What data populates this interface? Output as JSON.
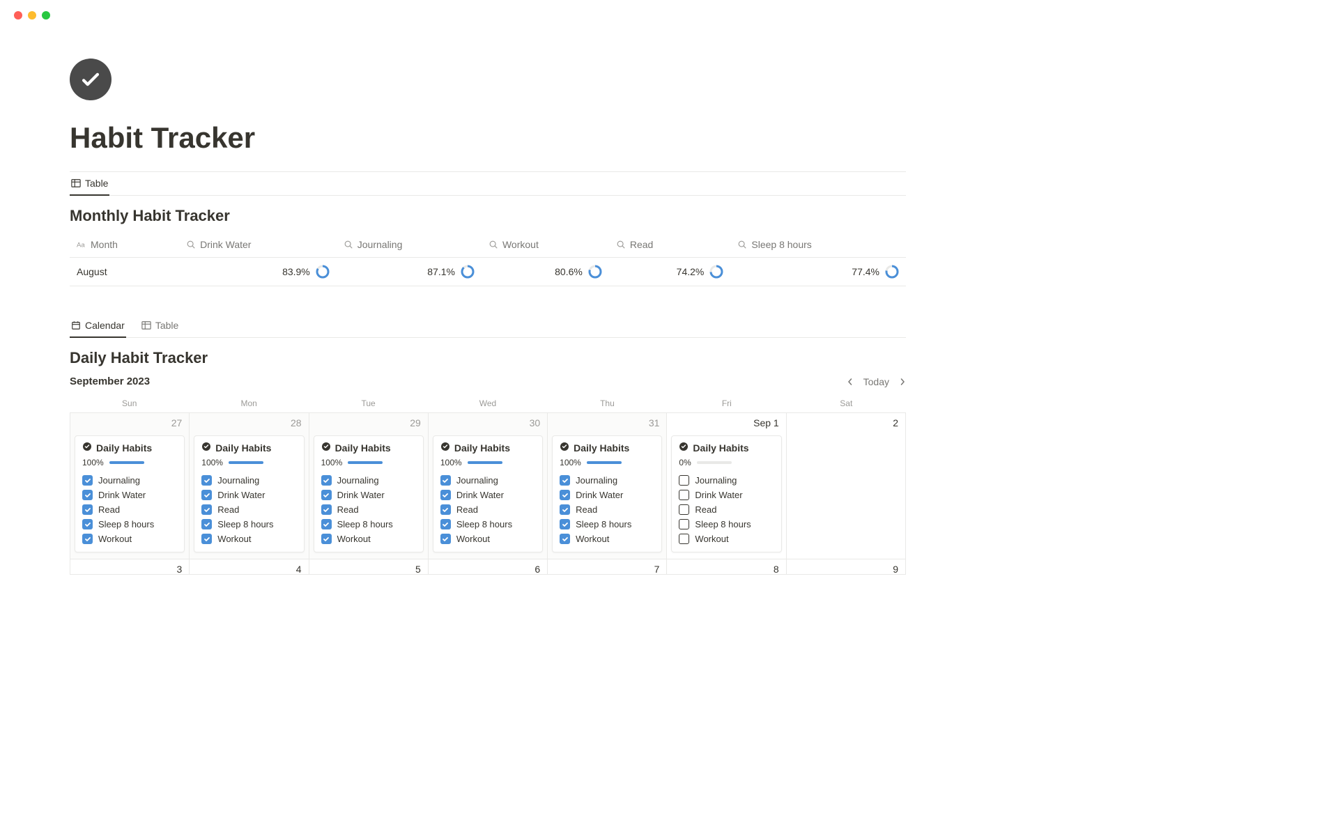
{
  "page": {
    "title": "Habit Tracker"
  },
  "monthly": {
    "view_tab_label": "Table",
    "title": "Monthly Habit Tracker",
    "columns": {
      "month": "Month",
      "drink_water": "Drink Water",
      "journaling": "Journaling",
      "workout": "Workout",
      "read": "Read",
      "sleep": "Sleep 8 hours"
    },
    "row": {
      "month": "August",
      "drink_water": "83.9%",
      "journaling": "87.1%",
      "workout": "80.6%",
      "read": "74.2%",
      "sleep": "77.4%"
    }
  },
  "daily": {
    "view_tabs": {
      "calendar": "Calendar",
      "table": "Table"
    },
    "title": "Daily Habit Tracker",
    "month_label": "September 2023",
    "today_label": "Today",
    "weekdays": [
      "Sun",
      "Mon",
      "Tue",
      "Wed",
      "Thu",
      "Fri",
      "Sat"
    ],
    "dates_row1": [
      "27",
      "28",
      "29",
      "30",
      "31",
      "Sep 1",
      "2"
    ],
    "dates_row2": [
      "3",
      "4",
      "5",
      "6",
      "7",
      "8",
      "9"
    ],
    "card_title": "Daily Habits",
    "habits": [
      "Journaling",
      "Drink Water",
      "Read",
      "Sleep 8 hours",
      "Workout"
    ],
    "progress_full": "100%",
    "progress_zero": "0%"
  },
  "colors": {
    "accent": "#4a8fd8"
  }
}
